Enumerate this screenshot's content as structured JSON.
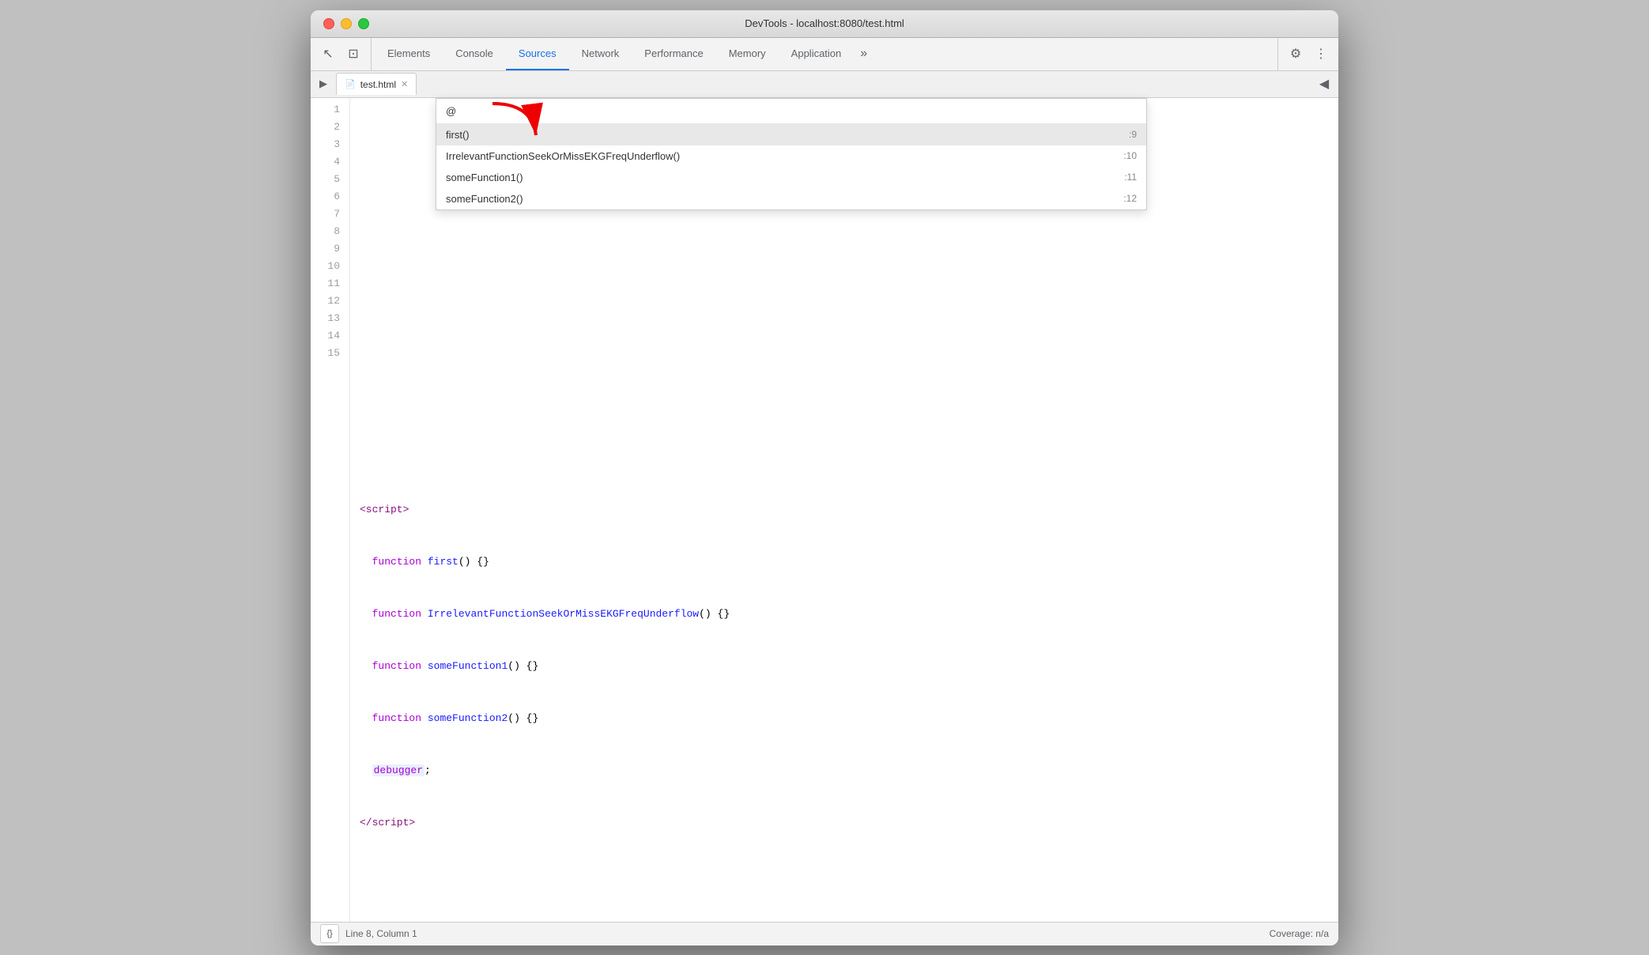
{
  "window": {
    "title": "DevTools - localhost:8080/test.html"
  },
  "tabs": [
    {
      "id": "elements",
      "label": "Elements",
      "active": false
    },
    {
      "id": "console",
      "label": "Console",
      "active": false
    },
    {
      "id": "sources",
      "label": "Sources",
      "active": true
    },
    {
      "id": "network",
      "label": "Network",
      "active": false
    },
    {
      "id": "performance",
      "label": "Performance",
      "active": false
    },
    {
      "id": "memory",
      "label": "Memory",
      "active": false
    },
    {
      "id": "application",
      "label": "Application",
      "active": false
    }
  ],
  "file_tab": {
    "name": "test.html"
  },
  "autocomplete": {
    "search_value": "@",
    "items": [
      {
        "name": "first()",
        "line": ":9",
        "selected": true
      },
      {
        "name": "IrrelevantFunctionSeekOrMissEKGFreqUnderflow()",
        "line": ":10",
        "selected": false
      },
      {
        "name": "someFunction1()",
        "line": ":11",
        "selected": false
      },
      {
        "name": "someFunction2()",
        "line": ":12",
        "selected": false
      }
    ]
  },
  "code": {
    "lines": [
      {
        "num": "1",
        "content": ""
      },
      {
        "num": "2",
        "content": ""
      },
      {
        "num": "3",
        "content": ""
      },
      {
        "num": "4",
        "content": ""
      },
      {
        "num": "5",
        "content": ""
      },
      {
        "num": "6",
        "content": ""
      },
      {
        "num": "7",
        "content": ""
      },
      {
        "num": "8",
        "html": "<span class='tag-purple'>&lt;script&gt;</span>"
      },
      {
        "num": "9",
        "html": "  <span class='kw-purple'>function</span> <span class='fn-blue'>first</span>() {}"
      },
      {
        "num": "10",
        "html": "  <span class='kw-purple'>function</span> <span class='fn-blue'>IrrelevantFunctionSeekOrMissEKGFreqUnderflow</span>() {}"
      },
      {
        "num": "11",
        "html": "  <span class='kw-purple'>function</span> <span class='fn-blue'>someFunction1</span>() {}"
      },
      {
        "num": "12",
        "html": "  <span class='kw-purple'>function</span> <span class='fn-blue'>someFunction2</span>() {}"
      },
      {
        "num": "13",
        "html": "  <span class='debugger-highlight'>debugger</span>;"
      },
      {
        "num": "14",
        "html": "<span class='tag-purple'>&lt;/script&gt;</span>"
      },
      {
        "num": "15",
        "content": ""
      }
    ]
  },
  "status_bar": {
    "line_col": "Line 8, Column 1",
    "coverage": "Coverage: n/a"
  },
  "icons": {
    "cursor": "↖",
    "dock": "⊡",
    "more": "»",
    "settings": "⚙",
    "ellipsis": "⋮",
    "play": "▶",
    "back_dock": "◀"
  }
}
